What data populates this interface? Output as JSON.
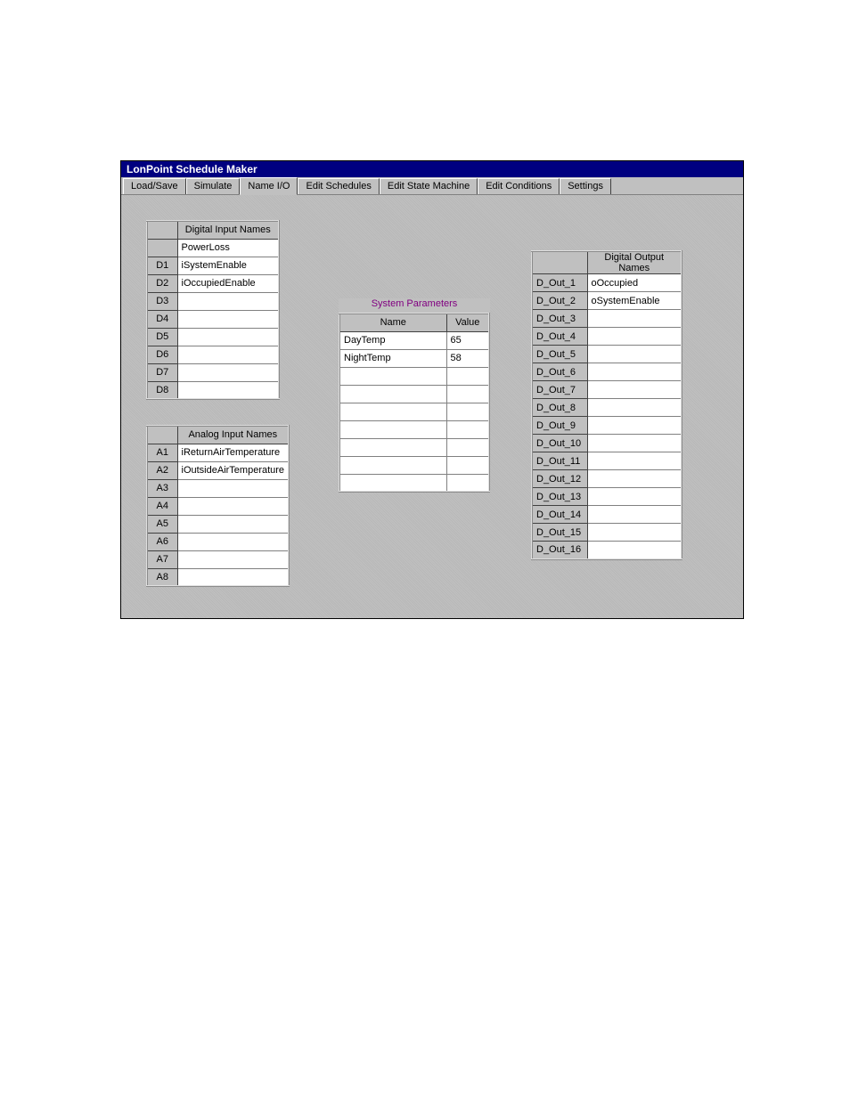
{
  "window": {
    "title": "LonPoint Schedule Maker"
  },
  "tabs": [
    {
      "label": "Load/Save"
    },
    {
      "label": "Simulate"
    },
    {
      "label": "Name I/O",
      "active": true
    },
    {
      "label": "Edit Schedules"
    },
    {
      "label": "Edit State Machine"
    },
    {
      "label": "Edit Conditions"
    },
    {
      "label": "Settings"
    }
  ],
  "digital_inputs": {
    "header": "Digital Input Names",
    "row0": {
      "label": "",
      "name": "PowerLoss"
    },
    "rows": [
      {
        "label": "D1",
        "name": "iSystemEnable"
      },
      {
        "label": "D2",
        "name": "iOccupiedEnable"
      },
      {
        "label": "D3",
        "name": ""
      },
      {
        "label": "D4",
        "name": ""
      },
      {
        "label": "D5",
        "name": ""
      },
      {
        "label": "D6",
        "name": ""
      },
      {
        "label": "D7",
        "name": ""
      },
      {
        "label": "D8",
        "name": ""
      }
    ]
  },
  "analog_inputs": {
    "header": "Analog Input Names",
    "rows": [
      {
        "label": "A1",
        "name": "iReturnAirTemperature"
      },
      {
        "label": "A2",
        "name": "iOutsideAirTemperature"
      },
      {
        "label": "A3",
        "name": ""
      },
      {
        "label": "A4",
        "name": ""
      },
      {
        "label": "A5",
        "name": ""
      },
      {
        "label": "A6",
        "name": ""
      },
      {
        "label": "A7",
        "name": ""
      },
      {
        "label": "A8",
        "name": ""
      }
    ]
  },
  "system_parameters": {
    "title": "System Parameters",
    "col_name": "Name",
    "col_value": "Value",
    "rows": [
      {
        "name": "DayTemp",
        "value": "65"
      },
      {
        "name": "NightTemp",
        "value": "58"
      },
      {
        "name": "",
        "value": ""
      },
      {
        "name": "",
        "value": ""
      },
      {
        "name": "",
        "value": ""
      },
      {
        "name": "",
        "value": ""
      },
      {
        "name": "",
        "value": ""
      },
      {
        "name": "",
        "value": ""
      },
      {
        "name": "",
        "value": ""
      }
    ]
  },
  "digital_outputs": {
    "header": "Digital Output Names",
    "rows": [
      {
        "label": "D_Out_1",
        "name": "oOccupied"
      },
      {
        "label": "D_Out_2",
        "name": "oSystemEnable"
      },
      {
        "label": "D_Out_3",
        "name": ""
      },
      {
        "label": "D_Out_4",
        "name": ""
      },
      {
        "label": "D_Out_5",
        "name": ""
      },
      {
        "label": "D_Out_6",
        "name": ""
      },
      {
        "label": "D_Out_7",
        "name": ""
      },
      {
        "label": "D_Out_8",
        "name": ""
      },
      {
        "label": "D_Out_9",
        "name": ""
      },
      {
        "label": "D_Out_10",
        "name": ""
      },
      {
        "label": "D_Out_11",
        "name": ""
      },
      {
        "label": "D_Out_12",
        "name": ""
      },
      {
        "label": "D_Out_13",
        "name": ""
      },
      {
        "label": "D_Out_14",
        "name": ""
      },
      {
        "label": "D_Out_15",
        "name": ""
      },
      {
        "label": "D_Out_16",
        "name": ""
      }
    ]
  }
}
